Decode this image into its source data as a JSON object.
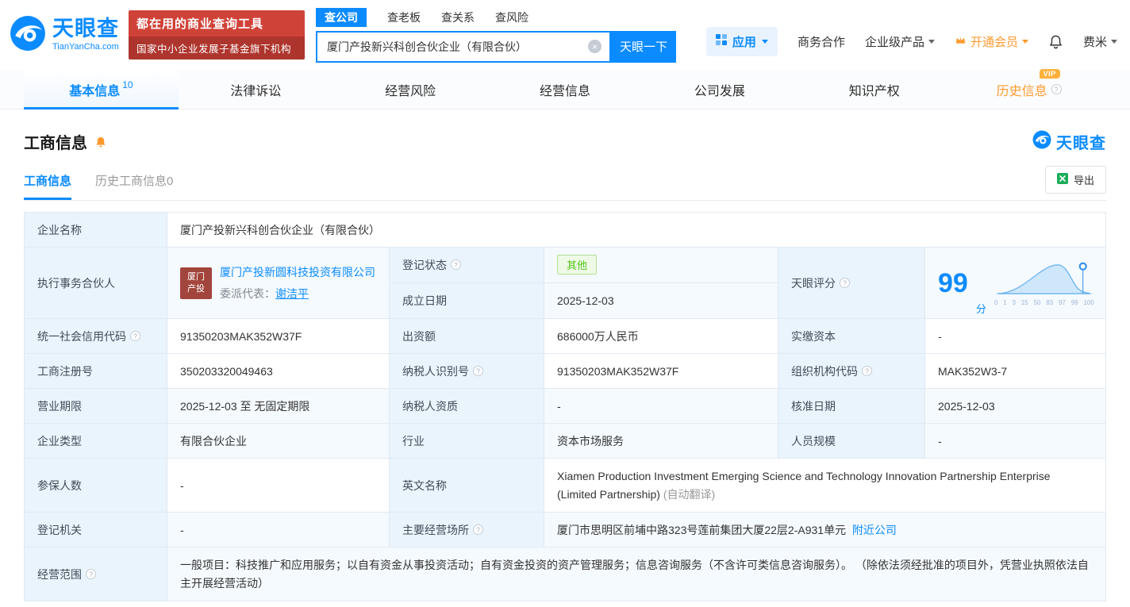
{
  "header": {
    "logo": {
      "name": "天眼查",
      "domain": "TianYanCha.com"
    },
    "promo": {
      "line1": "都在用的商业查询工具",
      "line2": "国家中小企业发展子基金旗下机构"
    },
    "search_tabs": [
      {
        "label": "查公司"
      },
      {
        "label": "查老板"
      },
      {
        "label": "查关系"
      },
      {
        "label": "查风险"
      }
    ],
    "search": {
      "value": "厦门产投新兴科创合伙企业（有限合伙）",
      "button_label": "天眼一下"
    },
    "nav": {
      "apps": "应用",
      "cooperation": "商务合作",
      "enterprise": "企业级产品",
      "vip": "开通会员",
      "user": "费米"
    }
  },
  "nav_tabs": [
    {
      "label": "基本信息",
      "count": "10"
    },
    {
      "label": "法律诉讼"
    },
    {
      "label": "经营风险"
    },
    {
      "label": "经营信息"
    },
    {
      "label": "公司发展"
    },
    {
      "label": "知识产权"
    },
    {
      "label": "历史信息",
      "badge": "VIP"
    }
  ],
  "section": {
    "title": "工商信息",
    "brand": "天眼查",
    "subtabs": [
      {
        "label": "工商信息"
      },
      {
        "label": "历史工商信息0"
      }
    ],
    "export_label": "导出"
  },
  "info": {
    "company_name": {
      "label": "企业名称",
      "value": "厦门产投新兴科创合伙企业（有限合伙）"
    },
    "partner": {
      "label": "执行事务合伙人",
      "logo_line1": "厦门",
      "logo_line2": "产投",
      "company": "厦门产投新圆科技投资有限公司",
      "delegate_prefix": "委派代表：",
      "delegate_name": "谢洁平"
    },
    "reg_status": {
      "label": "登记状态",
      "value": "其他"
    },
    "establish_date": {
      "label": "成立日期",
      "value": "2025-12-03"
    },
    "score": {
      "label": "天眼评分",
      "value": "99",
      "unit": "分",
      "axis": [
        "0",
        "1",
        "3",
        "15",
        "50",
        "83",
        "97",
        "99",
        "100"
      ]
    },
    "credit_code": {
      "label": "统一社会信用代码",
      "value": "91350203MAK352W37F"
    },
    "capital": {
      "label": "出资额",
      "value": "686000万人民币"
    },
    "paid_in": {
      "label": "实缴资本",
      "value": "-"
    },
    "reg_no": {
      "label": "工商注册号",
      "value": "350203320049463"
    },
    "tax_id": {
      "label": "纳税人识别号",
      "value": "91350203MAK352W37F"
    },
    "org_code": {
      "label": "组织机构代码",
      "value": "MAK352W3-7"
    },
    "term": {
      "label": "营业期限",
      "value": "2025-12-03 至 无固定期限"
    },
    "tax_qualification": {
      "label": "纳税人资质",
      "value": "-"
    },
    "approval_date": {
      "label": "核准日期",
      "value": "2025-12-03"
    },
    "company_type": {
      "label": "企业类型",
      "value": "有限合伙企业"
    },
    "industry": {
      "label": "行业",
      "value": "资本市场服务"
    },
    "staff_scale": {
      "label": "人员规模",
      "value": "-"
    },
    "insured": {
      "label": "参保人数",
      "value": "-"
    },
    "english_name": {
      "label": "英文名称",
      "value": "Xiamen Production Investment Emerging Science and Technology Innovation Partnership Enterprise (Limited Partnership)",
      "note": "(自动翻译)"
    },
    "reg_authority": {
      "label": "登记机关",
      "value": "-"
    },
    "address": {
      "label": "主要经营场所",
      "value": "厦门市思明区前埔中路323号莲前集团大厦22层2-A931单元",
      "link": "附近公司"
    },
    "scope": {
      "label": "经营范围",
      "value": "一般项目：科技推广和应用服务；以自有资金从事投资活动；自有资金投资的资产管理服务；信息咨询服务（不含许可类信息咨询服务）。 （除依法须经批准的项目外，凭营业执照依法自主开展经营活动）"
    }
  }
}
